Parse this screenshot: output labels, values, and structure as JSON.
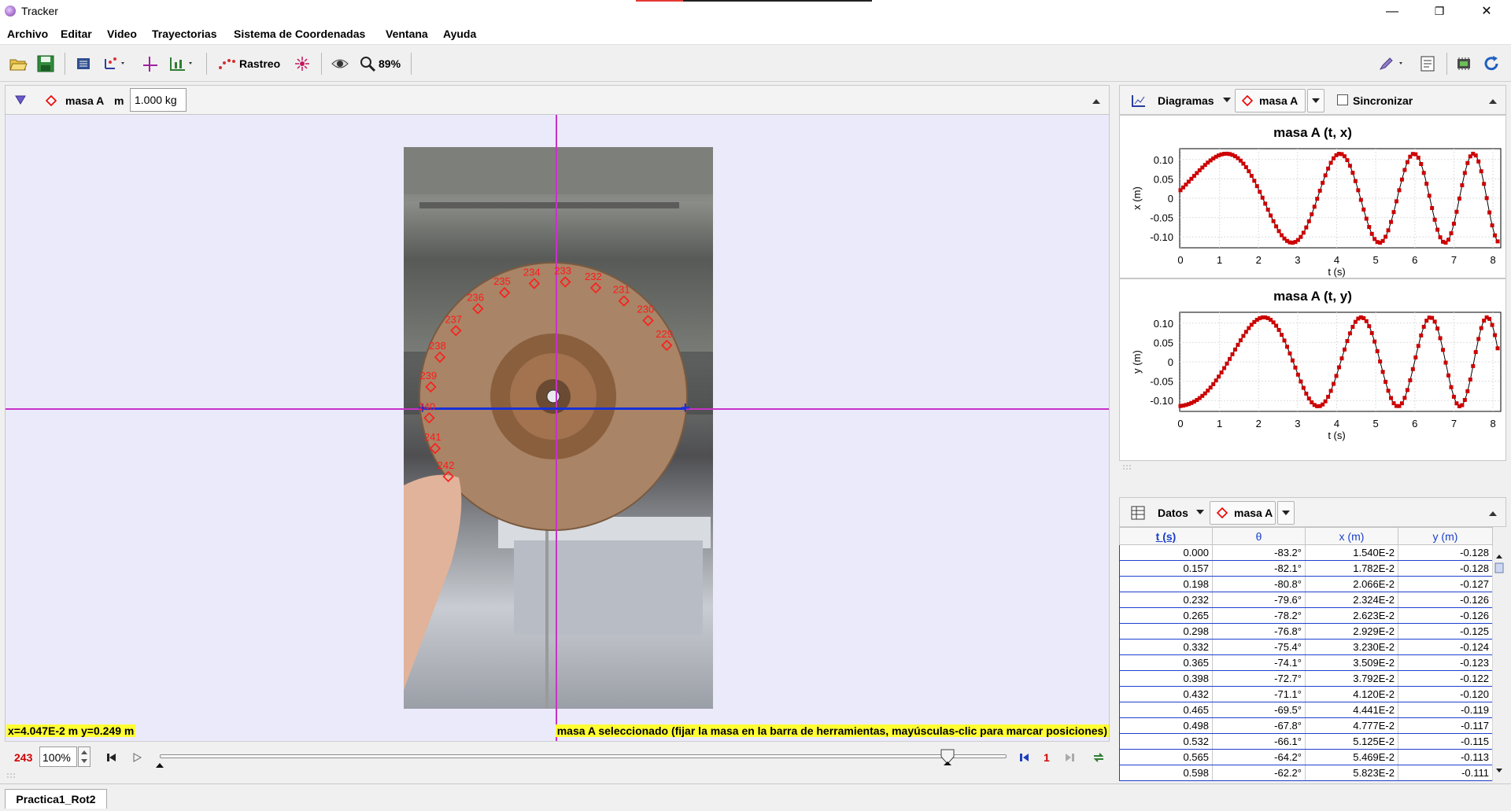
{
  "window": {
    "title": "Tracker",
    "minimize": "—",
    "restore": "❐",
    "close": "✕"
  },
  "menu": [
    "Archivo",
    "Editar",
    "Video",
    "Trayectorias",
    "Sistema de Coordenadas",
    "Ventana",
    "Ayuda"
  ],
  "toolbar": {
    "rastreo_label": "Rastreo",
    "zoom_label": "89%"
  },
  "track": {
    "name": "masa A",
    "mass_label": "m",
    "mass_value": "1.000 kg"
  },
  "frame_labels": [
    "229",
    "230",
    "231",
    "232",
    "233",
    "234",
    "235",
    "236",
    "237",
    "238",
    "239",
    "240",
    "241",
    "242"
  ],
  "status": {
    "coords": "x=4.047E-2 m  y=0.249 m",
    "hint": "masa A seleccionado (fijar la masa en la barra de herramientas, mayúsculas-clic para marcar posiciones)"
  },
  "player": {
    "frame": "243",
    "rate": "100%",
    "step": "1",
    "slider_fraction": 0.93
  },
  "tabs": {
    "main": "Practica1_Rot2"
  },
  "plots_header": {
    "diagrams_label": "Diagramas",
    "track_label": "masa A",
    "sync_label": "Sincronizar"
  },
  "plot1": {
    "title": "masa A (t, x)",
    "xlabel": "t (s)",
    "ylabel": "x (m)",
    "yticks": [
      "0.10",
      "0.05",
      "0",
      "-0.05",
      "-0.10"
    ],
    "xticks": [
      "0",
      "1",
      "2",
      "3",
      "4",
      "5",
      "6",
      "7",
      "8"
    ]
  },
  "plot2": {
    "title": "masa A (t, y)",
    "xlabel": "t (s)",
    "ylabel": "y (m)",
    "yticks": [
      "0.10",
      "0.05",
      "0",
      "-0.05",
      "-0.10"
    ],
    "xticks": [
      "0",
      "1",
      "2",
      "3",
      "4",
      "5",
      "6",
      "7",
      "8"
    ]
  },
  "table_header": {
    "data_label": "Datos",
    "track_label": "masa A"
  },
  "table": {
    "columns": [
      "t (s)",
      "θ",
      "x (m)",
      "y (m)"
    ],
    "rows": [
      [
        "0.000",
        "-83.2°",
        "1.540E-2",
        "-0.128"
      ],
      [
        "0.157",
        "-82.1°",
        "1.782E-2",
        "-0.128"
      ],
      [
        "0.198",
        "-80.8°",
        "2.066E-2",
        "-0.127"
      ],
      [
        "0.232",
        "-79.6°",
        "2.324E-2",
        "-0.126"
      ],
      [
        "0.265",
        "-78.2°",
        "2.623E-2",
        "-0.126"
      ],
      [
        "0.298",
        "-76.8°",
        "2.929E-2",
        "-0.125"
      ],
      [
        "0.332",
        "-75.4°",
        "3.230E-2",
        "-0.124"
      ],
      [
        "0.365",
        "-74.1°",
        "3.509E-2",
        "-0.123"
      ],
      [
        "0.398",
        "-72.7°",
        "3.792E-2",
        "-0.122"
      ],
      [
        "0.432",
        "-71.1°",
        "4.120E-2",
        "-0.120"
      ],
      [
        "0.465",
        "-69.5°",
        "4.441E-2",
        "-0.119"
      ],
      [
        "0.498",
        "-67.8°",
        "4.777E-2",
        "-0.117"
      ],
      [
        "0.532",
        "-66.1°",
        "5.125E-2",
        "-0.115"
      ],
      [
        "0.565",
        "-64.2°",
        "5.469E-2",
        "-0.113"
      ],
      [
        "0.598",
        "-62.2°",
        "5.823E-2",
        "-0.111"
      ]
    ]
  }
}
